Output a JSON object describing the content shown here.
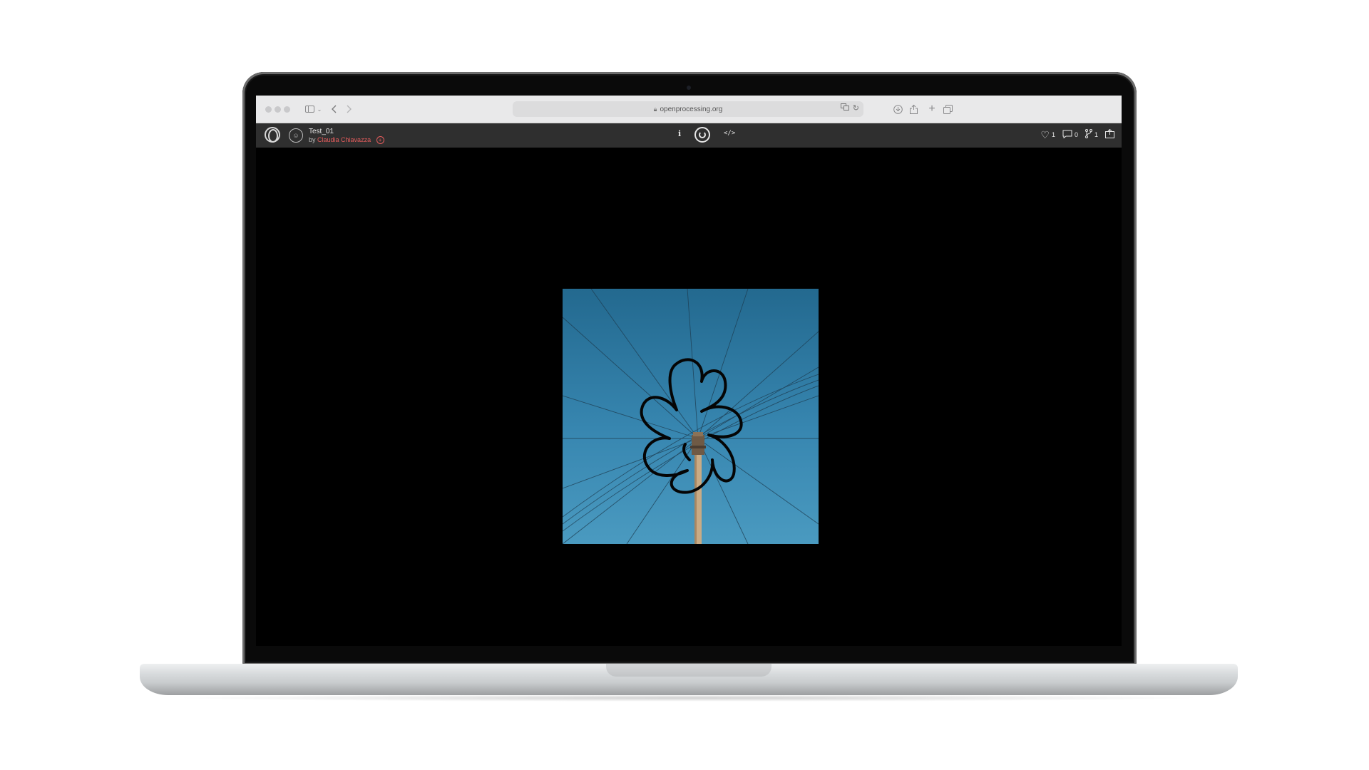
{
  "browser": {
    "url": "openprocessing.org",
    "icons": [
      "sidebar-icon",
      "back-icon",
      "forward-icon",
      "lock-icon",
      "translate-icon",
      "reload-icon",
      "download-icon",
      "share-icon",
      "new-tab-icon",
      "tabs-icon"
    ]
  },
  "sketch": {
    "title": "Test_01",
    "by_label": "by",
    "author": "Claudia Chiavazza",
    "follow_symbol": "+"
  },
  "toolbar": {
    "info_label": "i",
    "code_label": "</>",
    "likes": "1",
    "comments": "0",
    "forks": "1"
  },
  "colors": {
    "sky_top": "#23698f",
    "sky_bottom": "#4a9ac0",
    "author_accent": "#e45c5c",
    "toolbar_bg": "#2f2f2f"
  }
}
